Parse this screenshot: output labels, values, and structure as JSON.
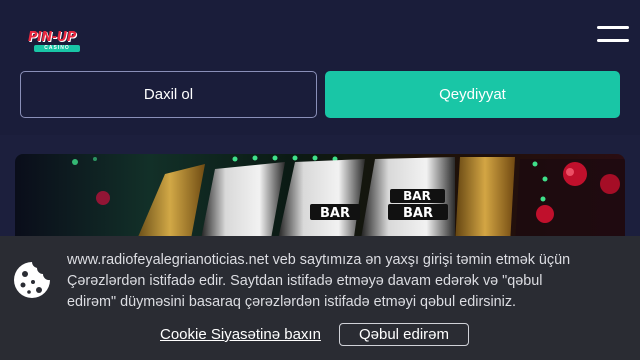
{
  "header": {
    "logo_text": "PIN-UP",
    "logo_sub": "CASINO",
    "menu_icon": "hamburger-menu-icon"
  },
  "auth": {
    "login_label": "Daxil ol",
    "register_label": "Qeydiyyat"
  },
  "banner": {
    "reel_labels": [
      "BAR",
      "BAR",
      "BAR"
    ]
  },
  "cookie_banner": {
    "icon": "cookie-icon",
    "line1": "www.radiofeyalegrianoticias.net veb saytımıza ən yaxşı girişi təmin etmək üçün",
    "line2": "Çərəzlərdən istifadə edir. Saytdan istifadə etməyə davam edərək və \"qəbul",
    "line3": "edirəm\" düyməsini basaraq çərəzlərdən istifadə etməyi qəbul edirsiniz.",
    "policy_link": "Cookie Siyasətinə baxın",
    "accept_label": "Qəbul edirəm"
  },
  "colors": {
    "accent": "#19c6a6",
    "background": "#1c1f3d",
    "cookie_bg": "#2a2c33"
  }
}
